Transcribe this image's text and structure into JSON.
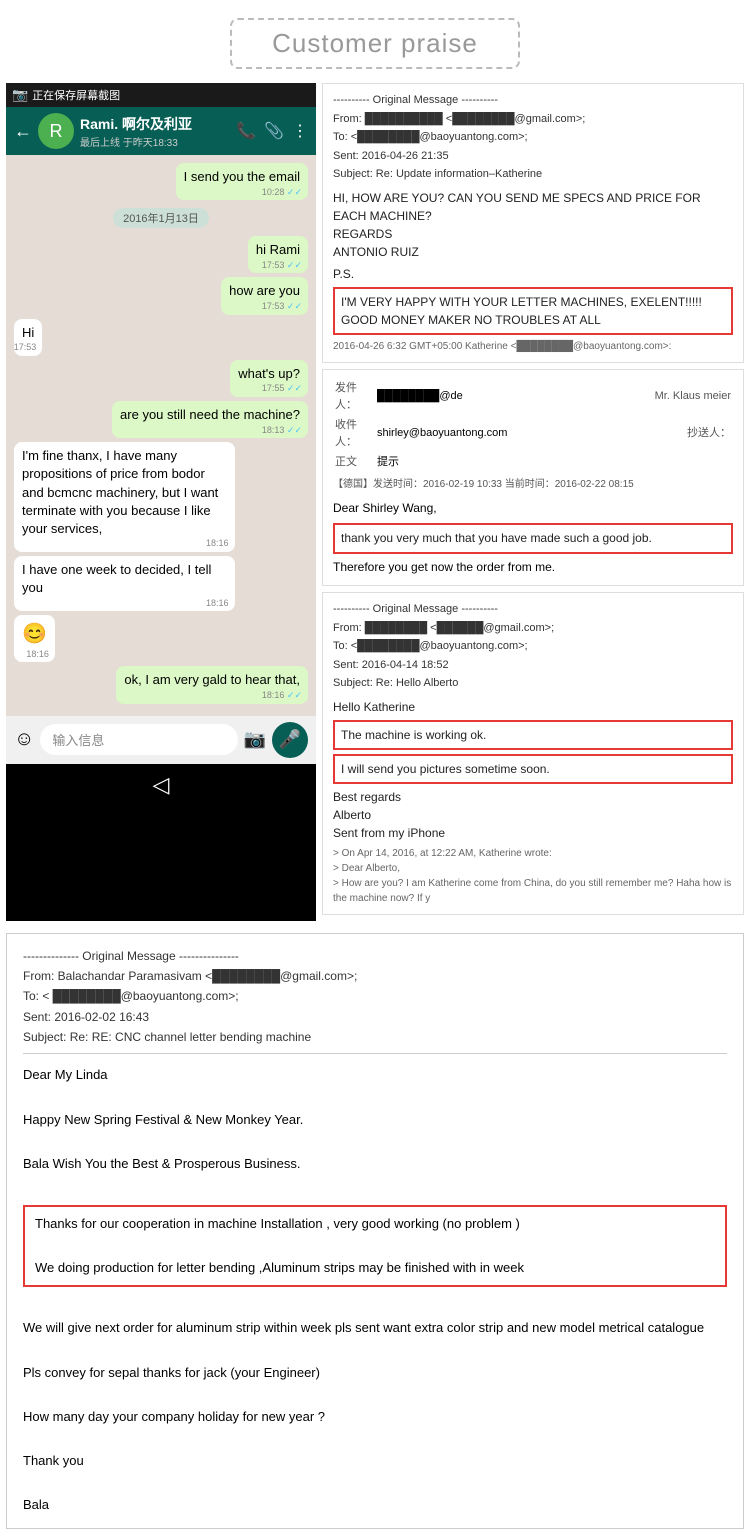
{
  "header": {
    "title": "Customer praise",
    "border_style": "dashed"
  },
  "whatsapp": {
    "screenshot_label": "正在保存屏幕截图",
    "contact_name": "Rami. 啊尔及利亚",
    "last_seen": "最后上线 于昨天18:33",
    "messages": [
      {
        "type": "sent",
        "text": "I send you the email",
        "time": "10:28",
        "ticks": true
      },
      {
        "type": "date",
        "text": "2016年1月13日"
      },
      {
        "type": "sent",
        "text": "hi Rami",
        "time": "17:53",
        "ticks": true
      },
      {
        "type": "sent",
        "text": "how are you",
        "time": "17:53",
        "ticks": true
      },
      {
        "type": "received",
        "text": "Hi",
        "time": "17:53"
      },
      {
        "type": "sent",
        "text": "what's up?",
        "time": "17:55",
        "ticks": true
      },
      {
        "type": "sent",
        "text": "are you still need the machine?",
        "time": "18:13",
        "ticks": true
      },
      {
        "type": "received",
        "text": "I'm fine thanx, I have many propositions of price from bodor and bcmcnc machinery, but I want terminate with you because I like your services,",
        "time": "18:16"
      },
      {
        "type": "received",
        "text": "I have one week to decided, I tell you",
        "time": "18:16"
      },
      {
        "type": "received",
        "text": "😊",
        "time": "18:16"
      },
      {
        "type": "sent",
        "text": "ok, I am very gald to hear that,",
        "time": "18:16",
        "ticks": true
      }
    ],
    "input_placeholder": "输入信息"
  },
  "email1": {
    "divider": "---------- Original Message ----------",
    "from": "From: ██████████ <████████@gmail.com>;",
    "to": "To: <████████@baoyuantong.com>;",
    "sent": "Sent: 2016-04-26 21:35",
    "subject": "Subject: Re: Update information–Katherine",
    "body1": "HI, HOW ARE YOU? CAN YOU SEND ME SPECS AND PRICE FOR EACH MACHINE?",
    "body2": "REGARDS",
    "body3": "ANTONIO RUIZ",
    "ps_label": "P.S.",
    "ps_highlight": "I'M VERY HAPPY WITH YOUR LETTER MACHINES, EXELENT!!!!! GOOD MONEY MAKER NO TROUBLES AT ALL",
    "footer": "2016-04-26 6:32 GMT+05:00 Katherine <████████@baoyuantong.com>:"
  },
  "email2": {
    "from_label": "发件人：",
    "from_val": "████████@de",
    "to_label": "收件人：",
    "to_val": "shirley@baoyuantong.com",
    "cc_label": "抄送人：",
    "cc_val": "",
    "flag_label": "正文",
    "flag_val": "提示",
    "note": "【德国】发送时间：2016-02-19 10:33 当前时间：2016-02-22 08:15",
    "greeting": "Dear Shirley Wang,",
    "highlight": "thank you very much that you have made such a good job.",
    "body": "Therefore you get now the order from me.",
    "mr_label": "Mr. Klaus meier"
  },
  "email3": {
    "divider": "---------- Original Message ----------",
    "from": "From: ████████ <██████@gmail.com>;",
    "to": "To: <████████@baoyuantong.com>;",
    "sent": "Sent: 2016-04-14 18:52",
    "subject": "Subject: Re: Hello Alberto",
    "greeting": "Hello Katherine",
    "highlight1": "The machine is working ok.",
    "highlight2": "I will send you pictures sometime soon.",
    "regards": "Best regards",
    "name": "Alberto",
    "sent_from": "Sent from my iPhone",
    "quote": "> On Apr 14, 2016, at 12:22 AM, Katherine wrote:",
    "quote2": "> Dear Alberto,",
    "quote3": "> How are you? I am Katherine come from China, do you still remember me? Haha how is the machine now? If y"
  },
  "email4": {
    "divider": "-------------- Original Message ---------------",
    "from": "From: Balachandar Paramasivam <████████@gmail.com>;",
    "to": "To:   < ████████@baoyuantong.com>;",
    "sent": "Sent: 2016-02-02 16:43",
    "subject": "Subject: Re: RE: CNC channel letter bending machine",
    "greeting": "Dear My Linda",
    "body1": "Happy New Spring Festival & New Monkey Year.",
    "body2": "Bala Wish You the Best & Prosperous Business.",
    "highlight1": "Thanks for our cooperation in machine Installation , very good working   (no problem )",
    "highlight2": "We doing production for letter bending ,Aluminum strips may be finished with in week",
    "body3": "We will give next order for aluminum strip within week pls  sent  want extra color strip and new model metrical  catalogue",
    "body4": "Pls convey for sepal thanks for jack (your Engineer)",
    "body5": "How many day your company holiday for new year ?",
    "body6": "Thank you",
    "body7": "Bala"
  },
  "colors": {
    "accent": "#e53935",
    "whatsapp_green": "#075e54",
    "whatsapp_light": "#dcf8c6",
    "header_border": "#bbb"
  }
}
